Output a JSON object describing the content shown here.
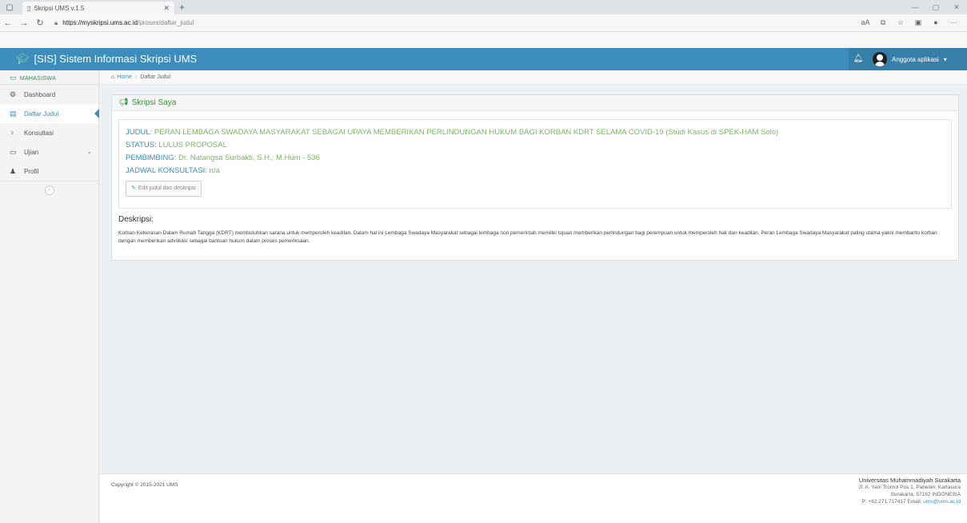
{
  "browser": {
    "tab_title": "Skripsi UMS v.1.5",
    "url_domain": "https://myskripsi.ums.ac.id",
    "url_path": "/proses/daftar_judul"
  },
  "app": {
    "title": "[SIS] Sistem Informasi Skripsi UMS",
    "user_name": "Anggota aplikasi"
  },
  "sidebar": {
    "section": "MAHASISWA",
    "items": [
      {
        "label": "Dashboard",
        "icon": "dashboard-icon"
      },
      {
        "label": "Daftar Judul",
        "icon": "list-icon"
      },
      {
        "label": "Konsultasi",
        "icon": "bulb-icon"
      },
      {
        "label": "Ujian",
        "icon": "monitor-icon"
      },
      {
        "label": "Profil",
        "icon": "user-icon"
      }
    ]
  },
  "breadcrumb": {
    "home": "Home",
    "current": "Daftar Judul"
  },
  "box": {
    "title": "Skripsi Saya",
    "judul_label": "JUDUL:",
    "judul_value": "PERAN LEMBAGA SWADAYA MASYARAKAT SEBAGAI UPAYA MEMBERIKAN PERLINDUNGAN HUKUM BAGI KORBAN KDRT SELAMA COVID-19 (Studi Kasus di SPEK-HAM Solo)",
    "status_label": "STATUS:",
    "status_value": "LULUS PROPOSAL",
    "pembimbing_label": "PEMBIMBING:",
    "pembimbing_value": "Dr. Natangsa Surbakti, S.H., M.Hum - 536",
    "jadwal_label": "JADWAL KONSULTASI:",
    "jadwal_value": "n/a",
    "edit_label": "Edit judul dan deskripsi",
    "desc_title": "Deskripsi:",
    "desc_text": "Korban Kekerasan Dalam Rumah Tangga (KDRT) membutuhkan sarana untuk memperoleh keadilan. Dalam hal ini Lembaga Swadaya Masyarakat sebagai lembaga non pemerintah memiliki tujuan memberikan perlindungan bagi perempuan untuk memperoleh hak dan keadilan. Peran Lembaga Swadaya Masyarakat paling utama yakni membantu korban dengan memberikan advokasi sebagai bantuan hukum dalam proses pemeriksaan."
  },
  "footer": {
    "copyright": "Copyright © 2015-2021 UMS",
    "university": "Universitas Muhammadiyah Surakarta",
    "address1": "Jl. A. Yani Tromol Pos 1, Pabelan, Kartasura",
    "address2": "Surakarta, 57162 INDONESIA",
    "phone_label": "P:",
    "phone": "+62.271.717417",
    "email_label": "Email:",
    "email": "ums@ums.ac.id"
  }
}
